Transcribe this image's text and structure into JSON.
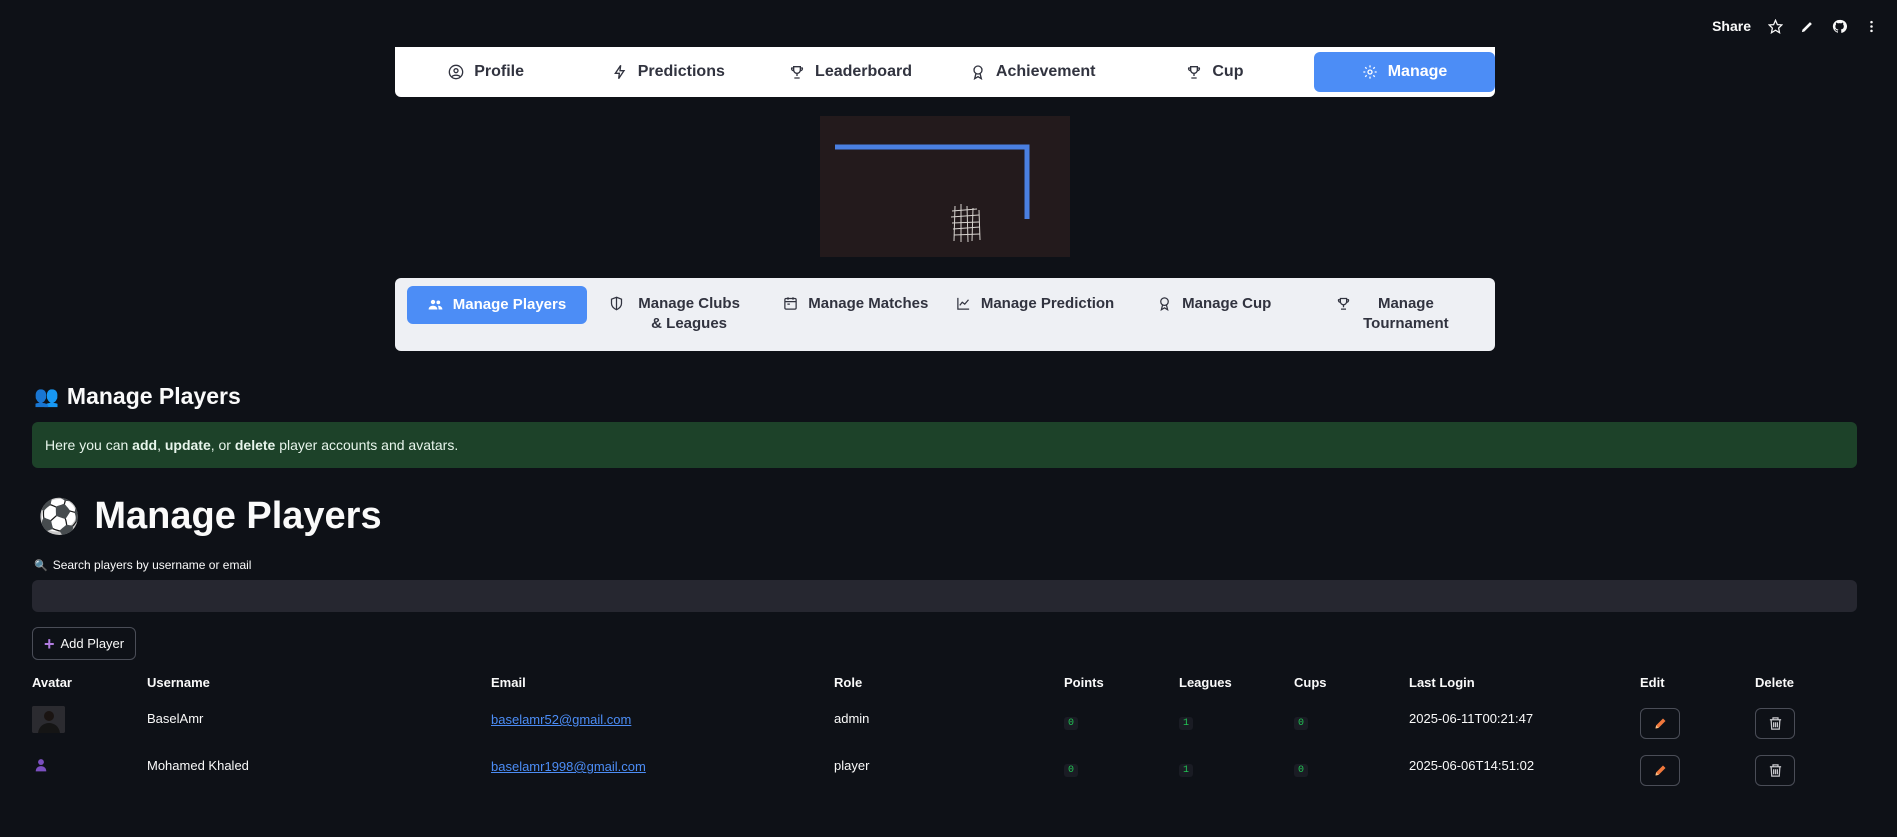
{
  "toolbar": {
    "share_label": "Share",
    "icons": [
      "star-icon",
      "pencil-icon",
      "github-icon",
      "more-vertical-icon"
    ]
  },
  "main_nav": {
    "items": [
      {
        "label": "Profile",
        "icon": "user-circle-icon"
      },
      {
        "label": "Predictions",
        "icon": "lightning-icon"
      },
      {
        "label": "Leaderboard",
        "icon": "trophy-icon"
      },
      {
        "label": "Achievement",
        "icon": "award-icon"
      },
      {
        "label": "Cup",
        "icon": "trophy-icon"
      },
      {
        "label": "Manage",
        "icon": "gear-icon",
        "active": true
      }
    ]
  },
  "sub_nav": {
    "items": [
      {
        "label": "Manage Players",
        "icon": "people-icon",
        "active": true
      },
      {
        "label": "Manage Clubs & Leagues",
        "icon": "shield-icon"
      },
      {
        "label": "Manage Matches",
        "icon": "calendar-icon"
      },
      {
        "label": "Manage Prediction",
        "icon": "chart-line-icon"
      },
      {
        "label": "Manage Cup",
        "icon": "award-icon"
      },
      {
        "label": "Manage Tournament",
        "icon": "trophy-icon"
      }
    ]
  },
  "section": {
    "small_heading": "Manage Players",
    "small_heading_emoji": "👥",
    "info_parts": [
      "Here you can ",
      "add",
      ", ",
      "update",
      ", or ",
      "delete",
      " player accounts and avatars."
    ],
    "big_heading": "Manage Players",
    "big_heading_emoji": "⚽"
  },
  "search": {
    "label": "Search players by username or email",
    "label_emoji": "🔍",
    "value": "",
    "placeholder": ""
  },
  "add_button": {
    "label": "Add Player",
    "icon": "plus-icon"
  },
  "table": {
    "headers": {
      "avatar": "Avatar",
      "username": "Username",
      "email": "Email",
      "role": "Role",
      "points": "Points",
      "leagues": "Leagues",
      "cups": "Cups",
      "last_login": "Last Login",
      "edit": "Edit",
      "delete": "Delete"
    },
    "rows": [
      {
        "avatar": "photo",
        "username": "BaselAmr",
        "email": "baselamr52@gmail.com",
        "role": "admin",
        "points": "0",
        "leagues": "1",
        "cups": "0",
        "last_login": "2025-06-11T00:21:47"
      },
      {
        "avatar": "user-icon",
        "username": "Mohamed Khaled",
        "email": "baselamr1998@gmail.com",
        "role": "player",
        "points": "0",
        "leagues": "1",
        "cups": "0",
        "last_login": "2025-06-06T14:51:02"
      }
    ]
  },
  "colors": {
    "background": "#0e1117",
    "accent": "#4c8df6",
    "info_bg": "#1d4229",
    "tag_green": "#21c354"
  }
}
